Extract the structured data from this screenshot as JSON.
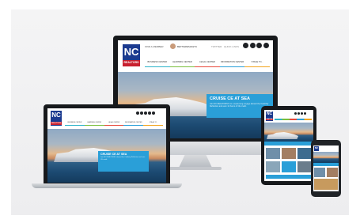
{
  "brand": {
    "logo_top": "NC",
    "logo_bottom": "REALTORS"
  },
  "monitor": {
    "topbar": [
      "FIND A MEMBER",
      "BETTERWHO&TC",
      "TWITTER",
      "QUICK LINKS"
    ],
    "nav": [
      "BUSINESS CENTER",
      "LEARNING CENTER",
      "LEGAL CENTER",
      "INFORMATION CENTER",
      "STAGE TO..."
    ],
    "promo_title": "CRUISE CE AT SEA",
    "promo_text": "Join NC REALTORS® on a week-long voyage aboard the Celebrity Reflection and earn 12 hours of CE credit."
  },
  "laptop": {
    "nav": [
      "BUSINESS CENTER",
      "LEARNING CENTER",
      "LEGAL CENTER",
      "INFORMATION CENTER",
      "STAGE TO"
    ],
    "promo_title": "CRUISE CE AT SEA",
    "promo_text": "Join NC REALTORS® aboard the Celebrity Reflection and earn CE credit."
  },
  "colors": {
    "logo_blue": "#1a3a8f",
    "logo_red": "#c8202f",
    "promo_blue": "#2a9fd8",
    "nav_accents": [
      "#2db3c9",
      "#7bbf3e",
      "#e84a3c",
      "#2a9fd8",
      "#f2a51e"
    ]
  },
  "icons": [
    "facebook-icon",
    "twitter-icon",
    "linkedin-icon",
    "youtube-icon",
    "instagram-icon"
  ]
}
